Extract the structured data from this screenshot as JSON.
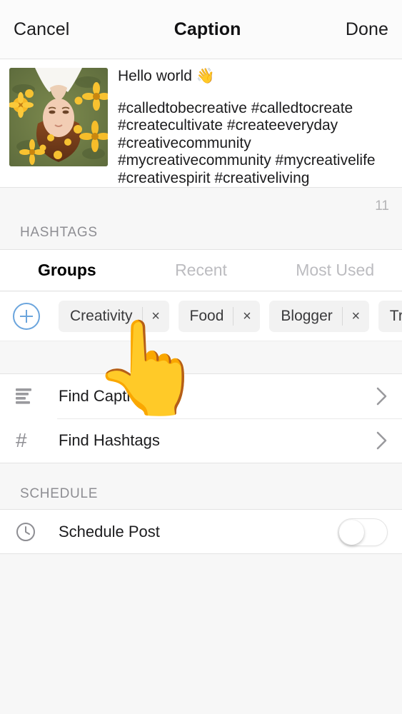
{
  "navbar": {
    "cancel_label": "Cancel",
    "title": "Caption",
    "done_label": "Done"
  },
  "caption": {
    "thumbnail_alt": "woman lying in grass with yellow flowers",
    "hello_line": "Hello world 👋",
    "hashtags_text": "#calledtobecreative #calledtocreate #createcultivate #createeveryday #creativecommunity #mycreativecommunity #mycreativelife #creativespirit #creativeliving"
  },
  "hashtags_section": {
    "counter": "11",
    "label": "HASHTAGS",
    "tabs": [
      {
        "label": "Groups",
        "active": true
      },
      {
        "label": "Recent",
        "active": false
      },
      {
        "label": "Most Used",
        "active": false
      }
    ],
    "add_icon": "plus-circle-icon",
    "add_accent_color": "#6ba5dd",
    "groups": [
      {
        "label": "Creativity",
        "remove_label": "×"
      },
      {
        "label": "Food",
        "remove_label": "×"
      },
      {
        "label": "Blogger",
        "remove_label": "×"
      },
      {
        "label": "Travel",
        "remove_label": "×"
      }
    ]
  },
  "find_rows": [
    {
      "icon": "lines-icon",
      "label": "Find Captions",
      "chevron": "chevron-right-icon"
    },
    {
      "icon": "hash-icon",
      "label": "Find Hashtags",
      "chevron": "chevron-right-icon"
    }
  ],
  "schedule_section": {
    "label": "SCHEDULE",
    "row": {
      "icon": "clock-icon",
      "label": "Schedule Post",
      "toggle_state": "off"
    }
  },
  "cursor": {
    "icon": "pointing-hand-cursor",
    "glyph": "👆"
  }
}
